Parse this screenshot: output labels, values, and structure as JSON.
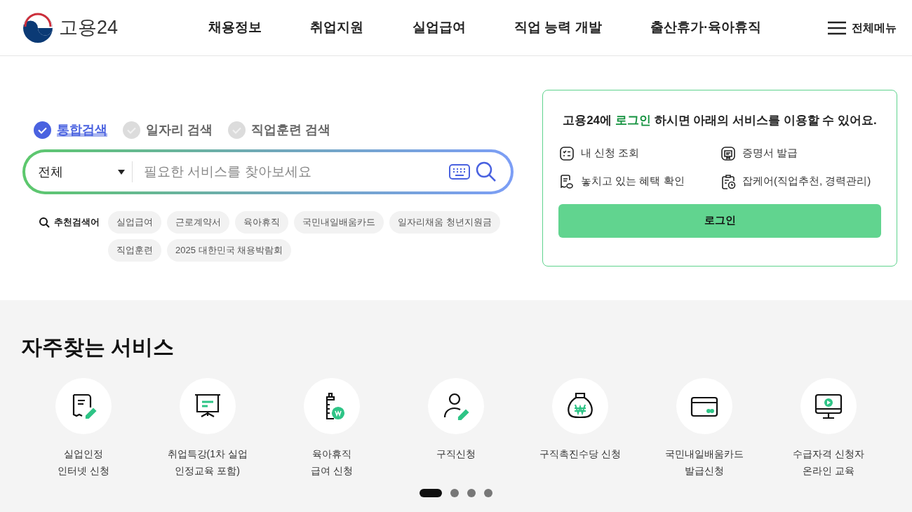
{
  "header": {
    "logo_text": "고용24",
    "nav": [
      "채용정보",
      "취업지원",
      "실업급여",
      "직업 능력 개발",
      "출산휴가·육아휴직"
    ],
    "all_menu": "전체메뉴"
  },
  "search": {
    "tabs": [
      {
        "label": "통합검색",
        "selected": true
      },
      {
        "label": "일자리 검색",
        "selected": false
      },
      {
        "label": "직업훈련 검색",
        "selected": false
      }
    ],
    "category": "전체",
    "placeholder": "필요한 서비스를 찾아보세요",
    "recommended_label": "추천검색어",
    "keywords": [
      "실업급여",
      "근로계약서",
      "육아휴직",
      "국민내일배움카드",
      "일자리채움 청년지원금",
      "직업훈련",
      "2025 대한민국 채용박람회"
    ]
  },
  "login_card": {
    "message": "고용24에 **로그인** 하시면 아래의 서비스를 이용할 수 있어요.",
    "services": [
      "내 신청 조회",
      "증명서 발급",
      "놓치고 있는 혜택 확인",
      "잡케어(직업추천, 경력관리)"
    ],
    "button": "로그인"
  },
  "frequent": {
    "title": "자주찾는 서비스",
    "items": [
      {
        "lines": [
          "실업인정",
          "인터넷 신청"
        ]
      },
      {
        "lines": [
          "취업특강(1차 실업",
          "인정교육 포함)"
        ]
      },
      {
        "lines": [
          "육아휴직",
          "급여 신청"
        ]
      },
      {
        "lines": [
          "구직신청"
        ]
      },
      {
        "lines": [
          "구직촉진수당 신청"
        ]
      },
      {
        "lines": [
          "국민내일배움카드",
          "발급신청"
        ]
      },
      {
        "lines": [
          "수급자격 신청자",
          "온라인 교육"
        ]
      }
    ],
    "pages": [
      {
        "selected": true
      },
      {
        "selected": false
      },
      {
        "selected": false
      },
      {
        "selected": false
      }
    ]
  }
}
